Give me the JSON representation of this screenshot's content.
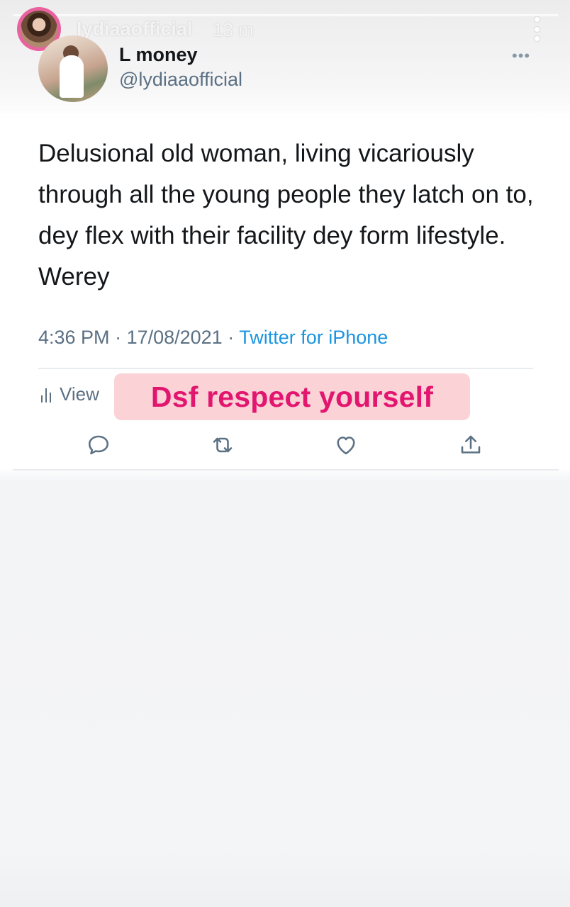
{
  "story": {
    "username": "lydiaaofficial",
    "time_ago": "13 m",
    "progress": 1.0
  },
  "tweet": {
    "display_name": "L money",
    "handle": "@lydiaaofficial",
    "more_label": "•••",
    "text": "Delusional old woman, living vicariously through all the young people they latch on to, dey flex with their facility dey form lifestyle. Werey",
    "time": "4:36 PM",
    "date": "17/08/2021",
    "separator": " · ",
    "source": "Twitter for iPhone",
    "view_label": "View",
    "actions": [
      "reply-icon",
      "retweet-icon",
      "like-icon",
      "share-icon"
    ]
  },
  "sticker": {
    "text": "Dsf respect yourself"
  },
  "colors": {
    "sticker_text": "#e2156f",
    "sticker_bg": "#fbd2d6",
    "link": "#1b95e0",
    "story_ring": "#e9629f"
  }
}
